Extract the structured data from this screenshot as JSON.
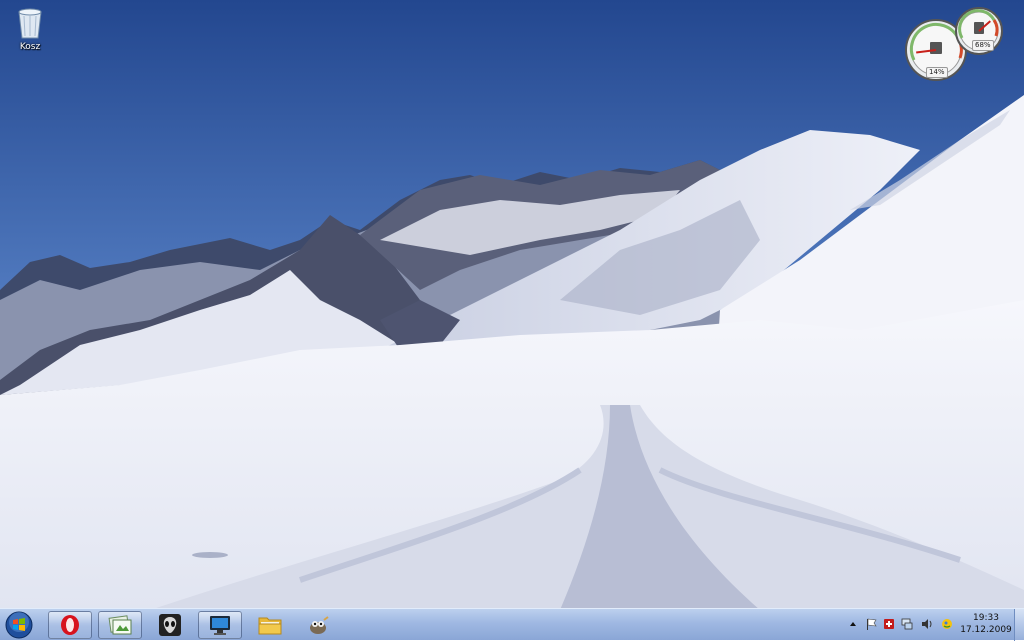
{
  "desktop": {
    "icons": [
      {
        "label": "Kosz",
        "icon": "recycle-bin-icon"
      }
    ]
  },
  "gadgets": {
    "cpu_meter": {
      "cpu_percent": "14%",
      "memory_percent": "68%",
      "cpu_value": 14,
      "memory_value": 68
    }
  },
  "taskbar": {
    "start_icon": "windows-start-orb",
    "items": [
      {
        "icon": "opera-icon",
        "running": true
      },
      {
        "icon": "photo-gallery-icon",
        "running": true
      },
      {
        "icon": "alien-icon",
        "running": false
      },
      {
        "icon": "monitor-icon",
        "running": true
      },
      {
        "icon": "folder-icon",
        "running": false
      },
      {
        "icon": "gimp-icon",
        "running": false
      }
    ],
    "tray": {
      "icons": [
        "show-hidden-icons-icon",
        "flag-icon",
        "antivirus-icon",
        "network-icon",
        "volume-icon",
        "messenger-icon"
      ]
    },
    "clock": {
      "time": "19:33",
      "date": "17.12.2009"
    }
  },
  "colors": {
    "sky_top": "#2a4f9a",
    "sky_bottom": "#8fb2de",
    "snow": "#f4f5fb",
    "taskbar": "#9fb8e2"
  }
}
